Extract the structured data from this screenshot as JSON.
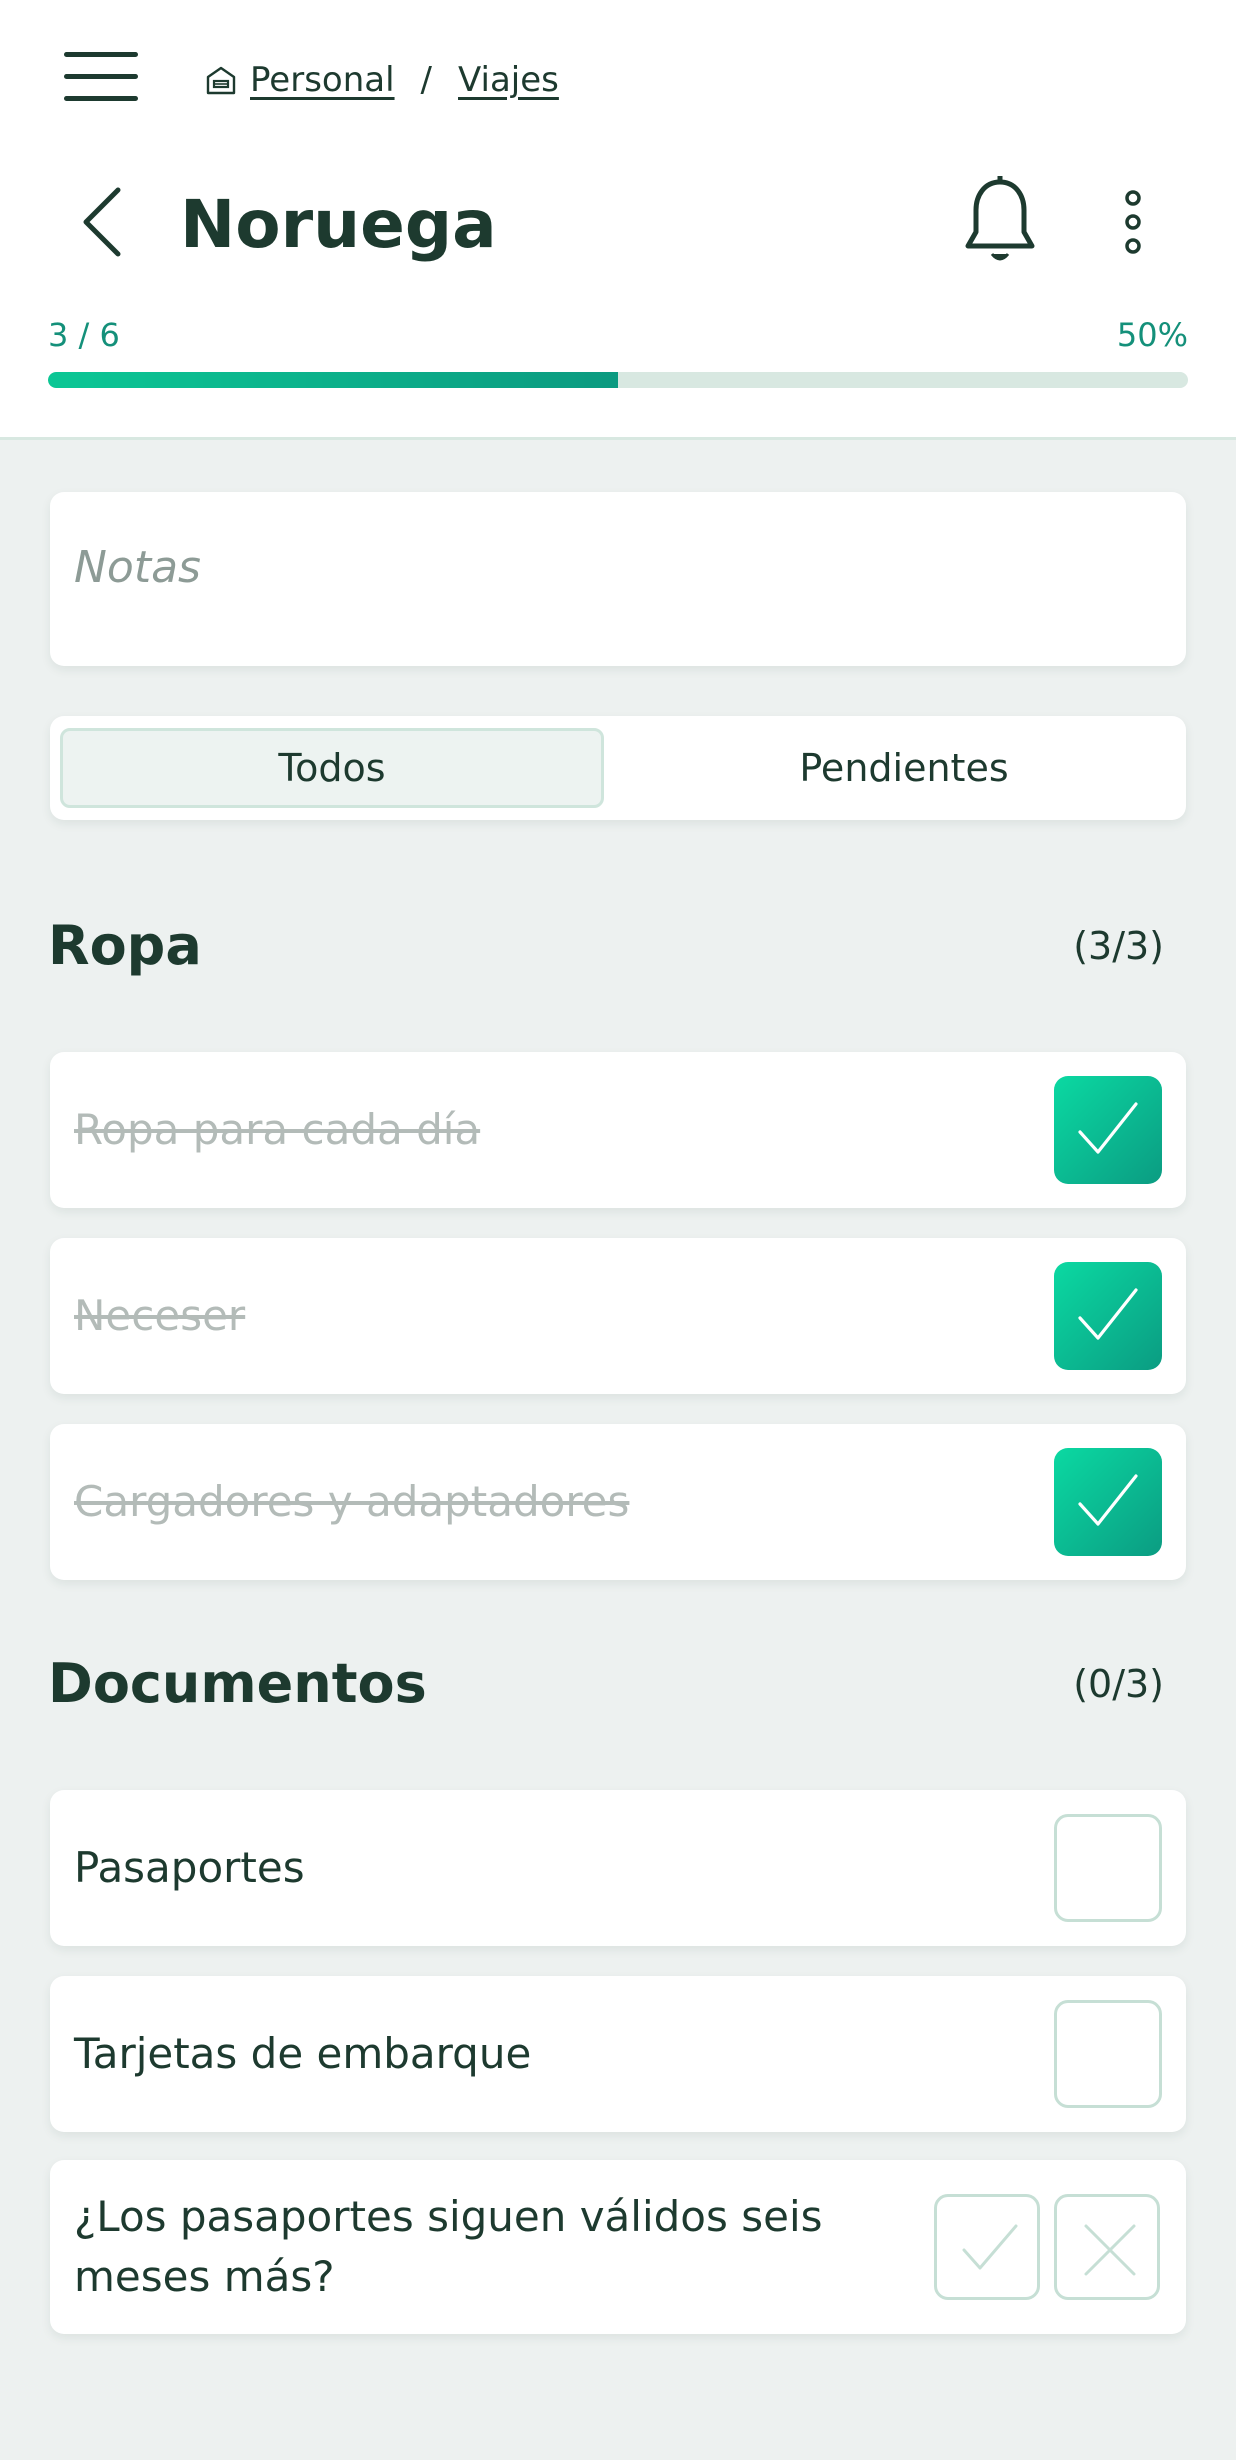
{
  "breadcrumb": {
    "home_icon": "home-icon",
    "items": [
      "Personal",
      "Viajes"
    ],
    "separator": "/"
  },
  "title": "Noruega",
  "progress": {
    "count_text": "3 / 6",
    "percent_text": "50%",
    "value": 0.5
  },
  "notes": {
    "placeholder": "Notas"
  },
  "filter": {
    "all_label": "Todos",
    "pending_label": "Pendientes",
    "selected": "Todos"
  },
  "sections": [
    {
      "title": "Ropa",
      "count": "(3/3)",
      "items": [
        {
          "label": "Ropa para cada día",
          "checked": true
        },
        {
          "label": "Neceser",
          "checked": true
        },
        {
          "label": "Cargadores y adaptadores",
          "checked": true
        }
      ]
    },
    {
      "title": "Documentos",
      "count": "(0/3)",
      "items": [
        {
          "label": "Pasaportes",
          "checked": false
        },
        {
          "label": "Tarjetas de embarque",
          "checked": false
        },
        {
          "label": "¿Los pasaportes siguen válidos seis meses más?",
          "type": "yes-no"
        }
      ]
    }
  ],
  "colors": {
    "accent": "#0bc795",
    "accent_dark": "#0b9a80",
    "text": "#1d3a2f",
    "background": "#edf1f0"
  }
}
